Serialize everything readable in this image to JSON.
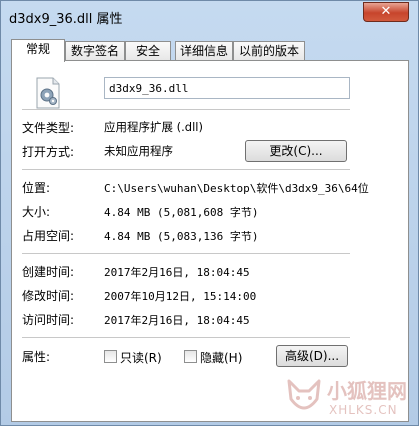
{
  "window": {
    "title": "d3dx9_36.dll 属性",
    "close_label": "✕"
  },
  "tabs": [
    {
      "label": "常规",
      "active": true
    },
    {
      "label": "数字签名",
      "active": false
    },
    {
      "label": "安全",
      "active": false
    },
    {
      "label": "详细信息",
      "active": false
    },
    {
      "label": "以前的版本",
      "active": false
    }
  ],
  "general": {
    "file_name": "d3dx9_36.dll",
    "file_type_label": "文件类型:",
    "file_type_value": "应用程序扩展 (.dll)",
    "open_with_label": "打开方式:",
    "open_with_value": "未知应用程序",
    "change_button": "更改(C)...",
    "location_label": "位置:",
    "location_value": "C:\\Users\\wuhan\\Desktop\\软件\\d3dx9_36\\64位",
    "size_label": "大小:",
    "size_value": "4.84 MB (5,081,608 字节)",
    "size_on_disk_label": "占用空间:",
    "size_on_disk_value": "4.84 MB (5,083,136 字节)",
    "created_label": "创建时间:",
    "created_value": "2017年2月16日, 18:04:45",
    "modified_label": "修改时间:",
    "modified_value": "2007年10月12日, 15:14:00",
    "accessed_label": "访问时间:",
    "accessed_value": "2017年2月16日, 18:04:45",
    "attributes_label": "属性:",
    "readonly_label": "只读(R)",
    "hidden_label": "隐藏(H)",
    "advanced_button": "高级(D)..."
  },
  "watermark": {
    "line1": "小狐狸网",
    "line2": "XHLKS.CN"
  }
}
